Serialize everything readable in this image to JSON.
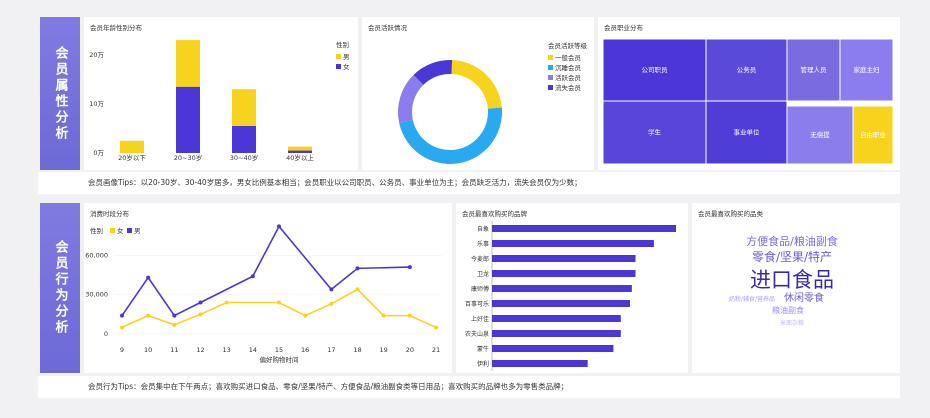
{
  "sections": {
    "attr_title": "会员属性分析",
    "behavior_title": "会员行为分析"
  },
  "colors": {
    "purple": "#4a37d6",
    "yellow": "#f7d31e",
    "light_purple": "#8b7df0",
    "cyan": "#2aa8f0"
  },
  "panels": {
    "age_gender": "会员年龄性别分布",
    "activity": "会员活跃情况",
    "occupation": "会员职业分布",
    "time_dist": "消费时段分布",
    "brands": "会员最喜欢购买的品牌",
    "categories": "会员最喜欢购买的品类"
  },
  "tips": {
    "attr": "会员画像Tips：以20-30岁、30-40岁居多，男女比例基本相当；会员职业以公司职员、公务员、事业单位为主；会员缺乏活力，流失会员仅为少数；",
    "behavior": "会员行为Tips：会员集中在下午两点；喜欢购买进口食品、零食/坚果/特产、方便食品/粮油副食类等日用品；喜欢购买的品牌也多为零售类品牌；"
  },
  "chart_data": [
    {
      "type": "bar",
      "title": "会员年龄性别分布",
      "legend_title": "性别",
      "categories": [
        "20岁以下",
        "20~30岁",
        "30~40岁",
        "40岁以上"
      ],
      "series": [
        {
          "name": "女",
          "values": [
            0,
            13.5,
            5.5,
            0.5
          ]
        },
        {
          "name": "男",
          "values": [
            2.5,
            9.5,
            7.5,
            0.8
          ]
        }
      ],
      "yticks": [
        "0万",
        "10万",
        "20万"
      ],
      "ylim": [
        0,
        22
      ]
    },
    {
      "type": "pie",
      "title": "会员活跃情况",
      "legend_title": "会员活跃等级",
      "slices": [
        {
          "name": "一般会员",
          "value": 23
        },
        {
          "name": "沉睡会员",
          "value": 48
        },
        {
          "name": "活跃会员",
          "value": 16
        },
        {
          "name": "流失会员",
          "value": 13
        }
      ]
    },
    {
      "type": "heatmap",
      "title": "会员职业分布",
      "cells": [
        {
          "name": "公司职员"
        },
        {
          "name": "公务员"
        },
        {
          "name": "管理人员"
        },
        {
          "name": "家庭主妇"
        },
        {
          "name": "学生"
        },
        {
          "name": "事业单位"
        },
        {
          "name": "无偿提"
        },
        {
          "name": "自由职业"
        }
      ]
    },
    {
      "type": "line",
      "title": "消费时段分布",
      "legend_title": "性别",
      "x": [
        9,
        10,
        11,
        12,
        13,
        14,
        15,
        16,
        17,
        18,
        19,
        20,
        21
      ],
      "xlabel": "偏好购物时间",
      "yticks": [
        "0",
        "30,000",
        "60,000"
      ],
      "ylim": [
        0,
        80000
      ],
      "series": [
        {
          "name": "女",
          "points": [
            [
              9,
              5000
            ],
            [
              10,
              14000
            ],
            [
              11,
              7000
            ],
            [
              12,
              15000
            ],
            [
              13,
              24000
            ],
            [
              15,
              24000
            ],
            [
              16,
              14000
            ],
            [
              17,
              23000
            ],
            [
              18,
              34000
            ],
            [
              19,
              14000
            ],
            [
              20,
              14000
            ],
            [
              21,
              5000
            ]
          ]
        },
        {
          "name": "男",
          "points": [
            [
              9,
              14000
            ],
            [
              10,
              43000
            ],
            [
              11,
              14000
            ],
            [
              12,
              24000
            ],
            [
              14,
              44000
            ],
            [
              15,
              82000
            ],
            [
              17,
              34000
            ],
            [
              18,
              50000
            ],
            [
              20,
              51000
            ]
          ]
        }
      ]
    },
    {
      "type": "bar",
      "orientation": "horizontal",
      "title": "会员最喜欢购买的品牌",
      "categories": [
        "自象",
        "乐事",
        "今麦郎",
        "卫龙",
        "康师傅",
        "百事可乐",
        "上好佳",
        "农夫山泉",
        "蒙牛",
        "伊利"
      ],
      "values": [
        100,
        88,
        78,
        78,
        76,
        75,
        70,
        70,
        66,
        52
      ],
      "xlim": [
        0,
        100
      ]
    },
    {
      "type": "table",
      "title": "会员最喜欢购买的品类",
      "words": [
        {
          "text": "方便食品/粮油副食",
          "weight": 2
        },
        {
          "text": "零食/坚果/特产",
          "weight": 2
        },
        {
          "text": "进口食品",
          "weight": 4
        },
        {
          "text": "休闲零食",
          "weight": 1.5
        },
        {
          "text": "粮油副食",
          "weight": 1
        },
        {
          "text": "奶粉/辅食/营养品",
          "weight": 0.7
        },
        {
          "text": "米面杂粮",
          "weight": 0.6
        }
      ]
    }
  ]
}
